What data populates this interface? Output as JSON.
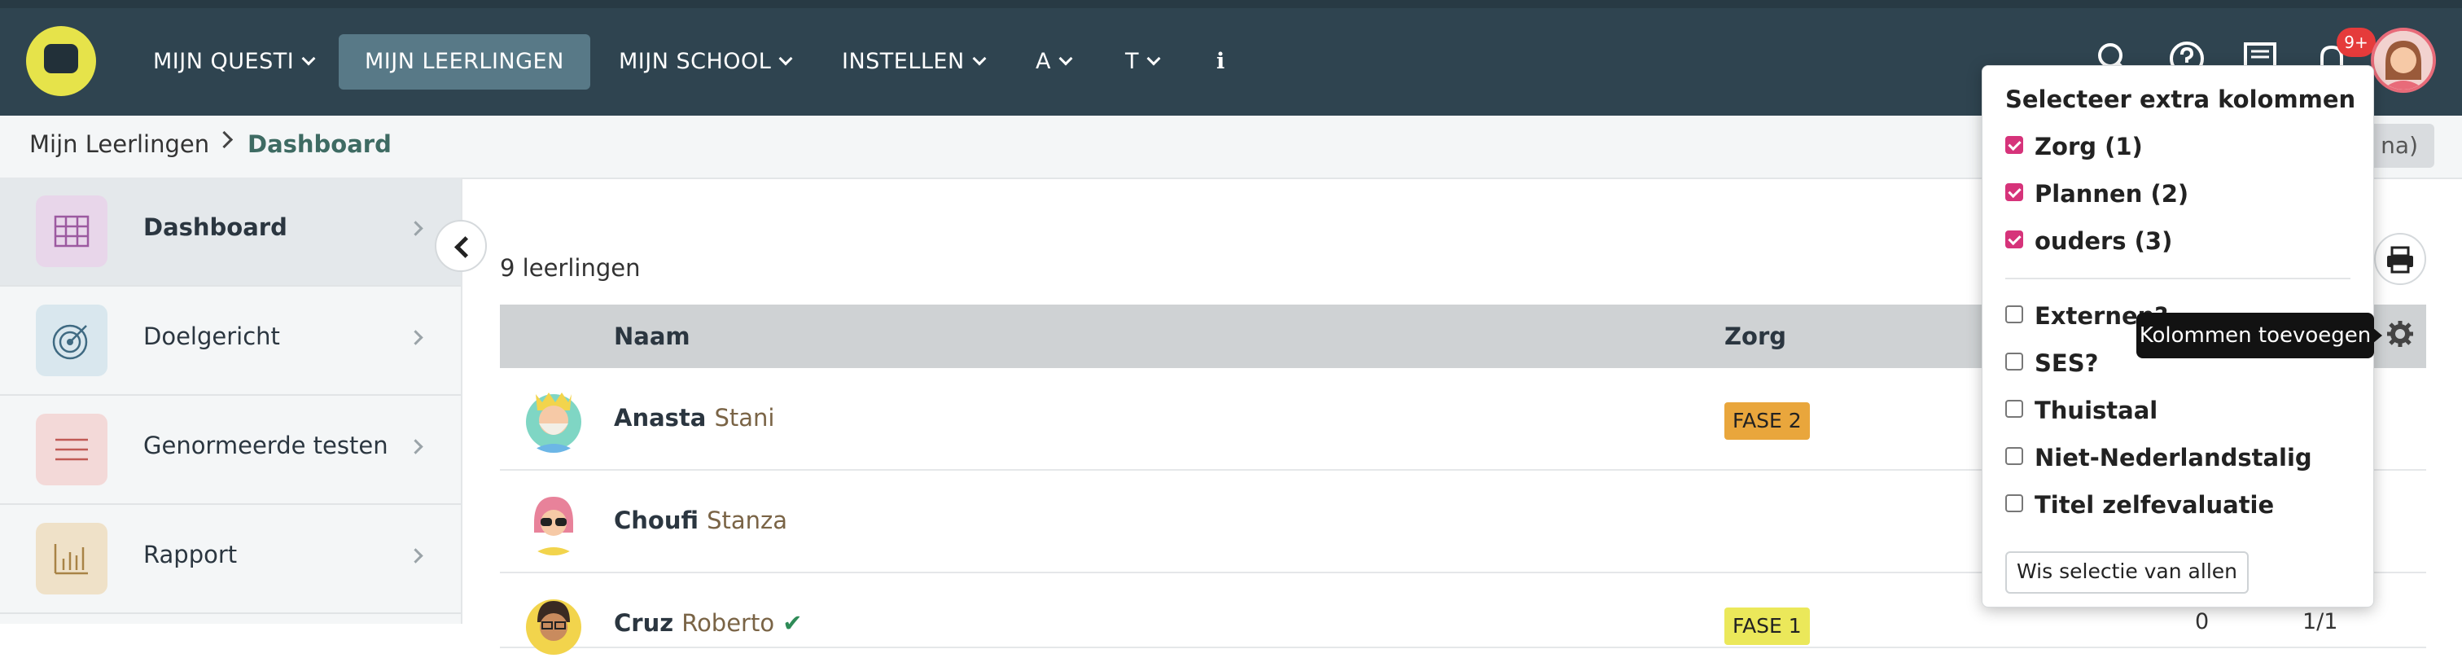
{
  "topnav": {
    "items": [
      "MIJN QUESTI",
      "MIJN LEERLINGEN",
      "MIJN SCHOOL",
      "INSTELLEN",
      "A",
      "T",
      "ℹ"
    ],
    "notification_badge": "9+"
  },
  "breadcrumb": {
    "root": "Mijn Leerlingen",
    "current": "Dashboard"
  },
  "right_button_label": "na)",
  "sidebar": {
    "items": [
      {
        "label": "Dashboard",
        "icon": "grid-icon",
        "color": "#e8d6ea"
      },
      {
        "label": "Doelgericht",
        "icon": "target-icon",
        "color": "#d9e7ee"
      },
      {
        "label": "Genormeerde testen",
        "icon": "lines-icon",
        "color": "#f3d9d8"
      },
      {
        "label": "Rapport",
        "icon": "bar-chart-icon",
        "color": "#efe1c8"
      }
    ]
  },
  "main": {
    "count_label": "9 leerlingen",
    "columns": {
      "name": "Naam",
      "zorg": "Zorg"
    },
    "rows": [
      {
        "first": "Anasta",
        "last": "Stani",
        "zorg": "FASE 2",
        "extra1": "",
        "extra2": ""
      },
      {
        "first": "Choufi",
        "last": "Stanza",
        "zorg": "",
        "extra1": "",
        "extra2": ""
      },
      {
        "first": "Cruz",
        "last": "Roberto",
        "zorg": "FASE 1",
        "extra1": "0",
        "extra2": "1/1"
      }
    ]
  },
  "popover": {
    "title": "Selecteer extra kolommen",
    "selected": [
      {
        "label": "Zorg (1)",
        "checked": true
      },
      {
        "label": "Plannen (2)",
        "checked": true
      },
      {
        "label": "ouders (3)",
        "checked": true
      }
    ],
    "available": [
      {
        "label": "Externen?",
        "checked": false
      },
      {
        "label": "SES?",
        "checked": false
      },
      {
        "label": "Thuistaal",
        "checked": false
      },
      {
        "label": "Niet-Nederlandstalig",
        "checked": false
      },
      {
        "label": "Titel zelfevaluatie",
        "checked": false
      }
    ],
    "clear_label": "Wis selectie van allen"
  },
  "tooltip": "Kolommen toevoegen"
}
